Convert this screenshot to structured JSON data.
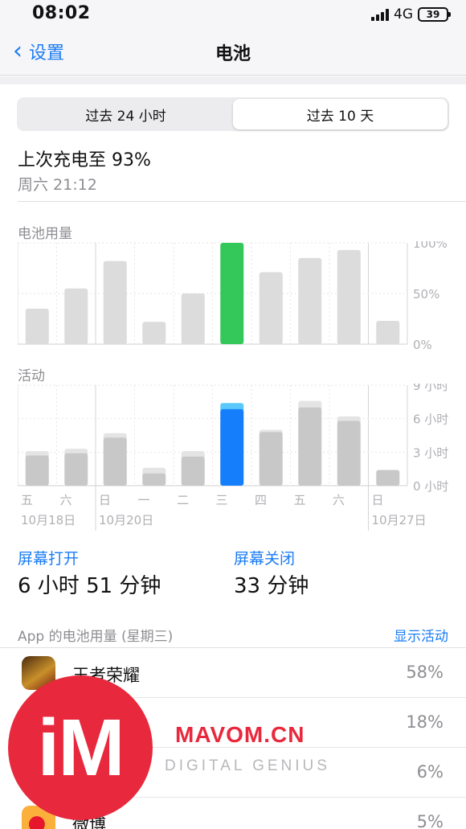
{
  "status_bar": {
    "time": "08:02",
    "network": "4G",
    "battery": "39"
  },
  "nav": {
    "back_label": "设置",
    "title": "电池"
  },
  "segments": [
    {
      "label": "过去 24 小时",
      "active": false
    },
    {
      "label": "过去 10 天",
      "active": true
    }
  ],
  "last_charge": {
    "text": "上次充电至 93%",
    "time": "周六 21:12"
  },
  "battery_chart_label": "电池用量",
  "activity_chart_label": "活动",
  "chart_data": [
    {
      "type": "bar",
      "title": "电池用量",
      "categories": [
        "五",
        "六",
        "日",
        "一",
        "二",
        "三",
        "四",
        "五",
        "六",
        "日"
      ],
      "values": [
        35,
        55,
        82,
        22,
        50,
        100,
        71,
        85,
        93,
        23
      ],
      "highlight_index": 5,
      "ylim": [
        0,
        100
      ],
      "yticks": [
        "100%",
        "50%",
        "0%"
      ],
      "colors": {
        "bar": "#dcdcdc",
        "highlight": "#34c759"
      }
    },
    {
      "type": "bar",
      "title": "活动",
      "categories": [
        "五",
        "六",
        "日",
        "一",
        "二",
        "三",
        "四",
        "五",
        "六",
        "日"
      ],
      "series": [
        {
          "values": [
            2.7,
            2.9,
            4.3,
            1.1,
            2.6,
            6.85,
            4.8,
            7.0,
            5.8,
            1.4
          ]
        },
        {
          "values": [
            0.4,
            0.4,
            0.4,
            0.5,
            0.5,
            0.55,
            0.2,
            0.6,
            0.4,
            0.0
          ]
        }
      ],
      "highlight_index": 5,
      "ylim": [
        0,
        9
      ],
      "yticks": [
        "9 小时",
        "6 小时",
        "3 小时",
        "0 小时"
      ],
      "date_labels": [
        {
          "text": "10月18日",
          "index": 0
        },
        {
          "text": "10月20日",
          "index": 2
        },
        {
          "text": "10月27日",
          "index": 9
        }
      ],
      "colors": {
        "screen_on": "#c8c8c8",
        "screen_off": "#e4e4e4",
        "highlight_on": "#147efb",
        "highlight_off": "#5ac8fa"
      }
    }
  ],
  "screen_on": {
    "label": "屏幕打开",
    "value": "6 小时 51 分钟"
  },
  "screen_off": {
    "label": "屏幕关闭",
    "value": "33 分钟"
  },
  "apps_header": "App 的电池用量 (星期三)",
  "show_activity": "显示活动",
  "apps": [
    {
      "name": "王者荣耀",
      "percent": "58%",
      "icon": "honor-of-kings-icon"
    },
    {
      "name": "",
      "percent": "18%",
      "icon": "app-icon"
    },
    {
      "name": "",
      "percent": "6%",
      "icon": "app-icon"
    },
    {
      "name": "微博",
      "percent": "5%",
      "icon": "weibo-icon"
    }
  ],
  "watermark": {
    "logo": "iM",
    "brand": "MAVOM.CN",
    "tagline": "DIGITAL GENIUS"
  }
}
